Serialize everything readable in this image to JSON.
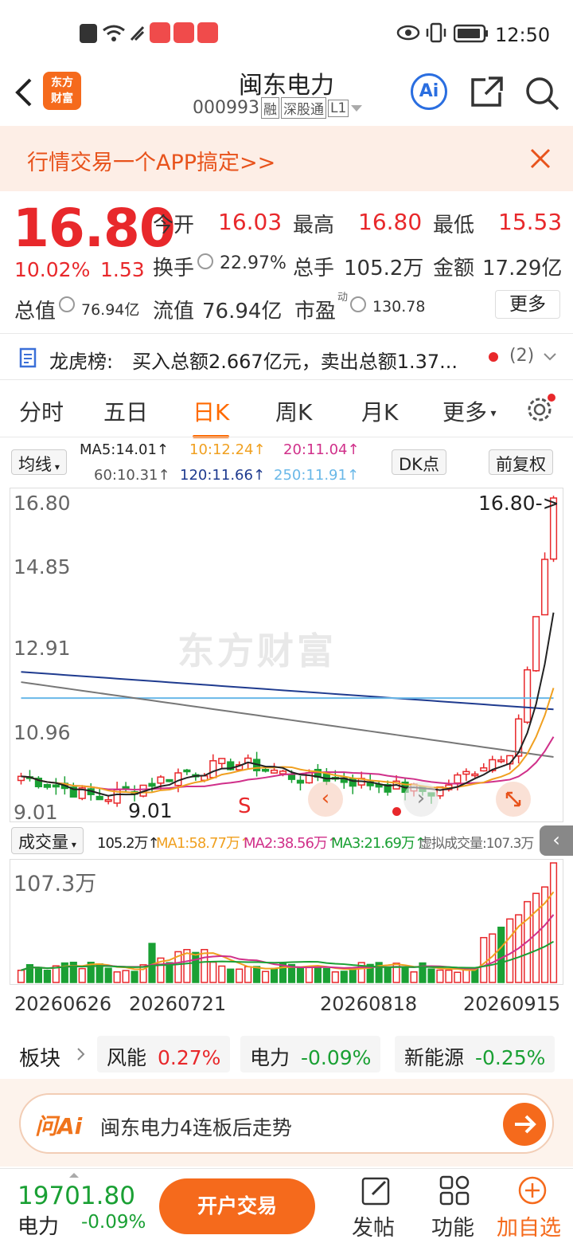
{
  "status": {
    "time": "12:50"
  },
  "header": {
    "brand_logo_text": "东方财富",
    "stock_name": "闽东电力",
    "stock_code": "000993",
    "badges": [
      "融",
      "深股通",
      "L1"
    ],
    "ai_label": "Ai"
  },
  "banner": {
    "text": "行情交易一个APP搞定>>"
  },
  "quote": {
    "price": "16.80",
    "change_pct": "10.02%",
    "change_amt": "1.53",
    "fields": {
      "open_label": "今开",
      "open_value": "16.03",
      "high_label": "最高",
      "high_value": "16.80",
      "low_label": "最低",
      "low_value": "15.53",
      "turnover_label": "换手",
      "turnover_value": "22.97%",
      "volume_label": "总手",
      "volume_value": "105.2万",
      "amount_label": "金额",
      "amount_value": "17.29亿",
      "mktcap_label": "总值",
      "mktcap_value": "76.94亿",
      "float_label": "流值",
      "float_value": "76.94亿",
      "pe_label": "市盈",
      "pe_sup": "动",
      "pe_value": "130.78",
      "more_label": "更多"
    }
  },
  "dragon_tiger": {
    "label": "龙虎榜:",
    "text": "买入总额2.667亿元，卖出总额1.37...",
    "count": "(2)"
  },
  "tabs": [
    "分时",
    "五日",
    "日K",
    "周K",
    "月K",
    "更多"
  ],
  "active_tab": "日K",
  "ma_panel": {
    "selector": "均线",
    "ma5": "MA5:14.01↑",
    "ma10": "10:12.24↑",
    "ma20": "20:11.04↑",
    "ma60": "60:10.31↑",
    "ma120": "120:11.66↑",
    "ma250": "250:11.91↑",
    "dk_label": "DK点",
    "adjust_label": "前复权"
  },
  "kline": {
    "y_labels": [
      "16.80",
      "14.85",
      "12.91",
      "10.96",
      "9.01"
    ],
    "max_label": "16.80->",
    "min_label": "9.01",
    "marker_s": "S",
    "watermark": "东方财富",
    "colors": {
      "up": "#e8282b",
      "down": "#1aa034",
      "ma5": "#222222",
      "ma10": "#f0a020",
      "ma20": "#d0308a",
      "ma60": "#777777",
      "ma120": "#1f3b8f",
      "ma250": "#6ab8e8"
    }
  },
  "volume_panel": {
    "selector": "成交量",
    "current": "105.2万↑",
    "ma1": "MA1:58.77万↑",
    "ma2": "MA2:38.56万↑",
    "ma3": "MA3:21.69万↑",
    "virtual": "虚拟成交量:107.3万",
    "max_label": "107.3万",
    "dates": [
      "20260626",
      "20260721",
      "20260818",
      "20260915"
    ]
  },
  "sectors": {
    "label": "板块",
    "items": [
      {
        "name": "风能",
        "change": "0.27%",
        "dir": "up"
      },
      {
        "name": "电力",
        "change": "-0.09%",
        "dir": "down"
      },
      {
        "name": "新能源",
        "change": "-0.25%",
        "dir": "down"
      }
    ]
  },
  "ai_search": {
    "logo": "问Ai",
    "query": "闽东电力4连板后走势"
  },
  "bottom": {
    "index_value": "19701.80",
    "index_name": "电力",
    "index_change": "-0.09%",
    "open_account": "开户交易",
    "post": "发帖",
    "functions": "功能",
    "add_watch": "加自选"
  }
}
